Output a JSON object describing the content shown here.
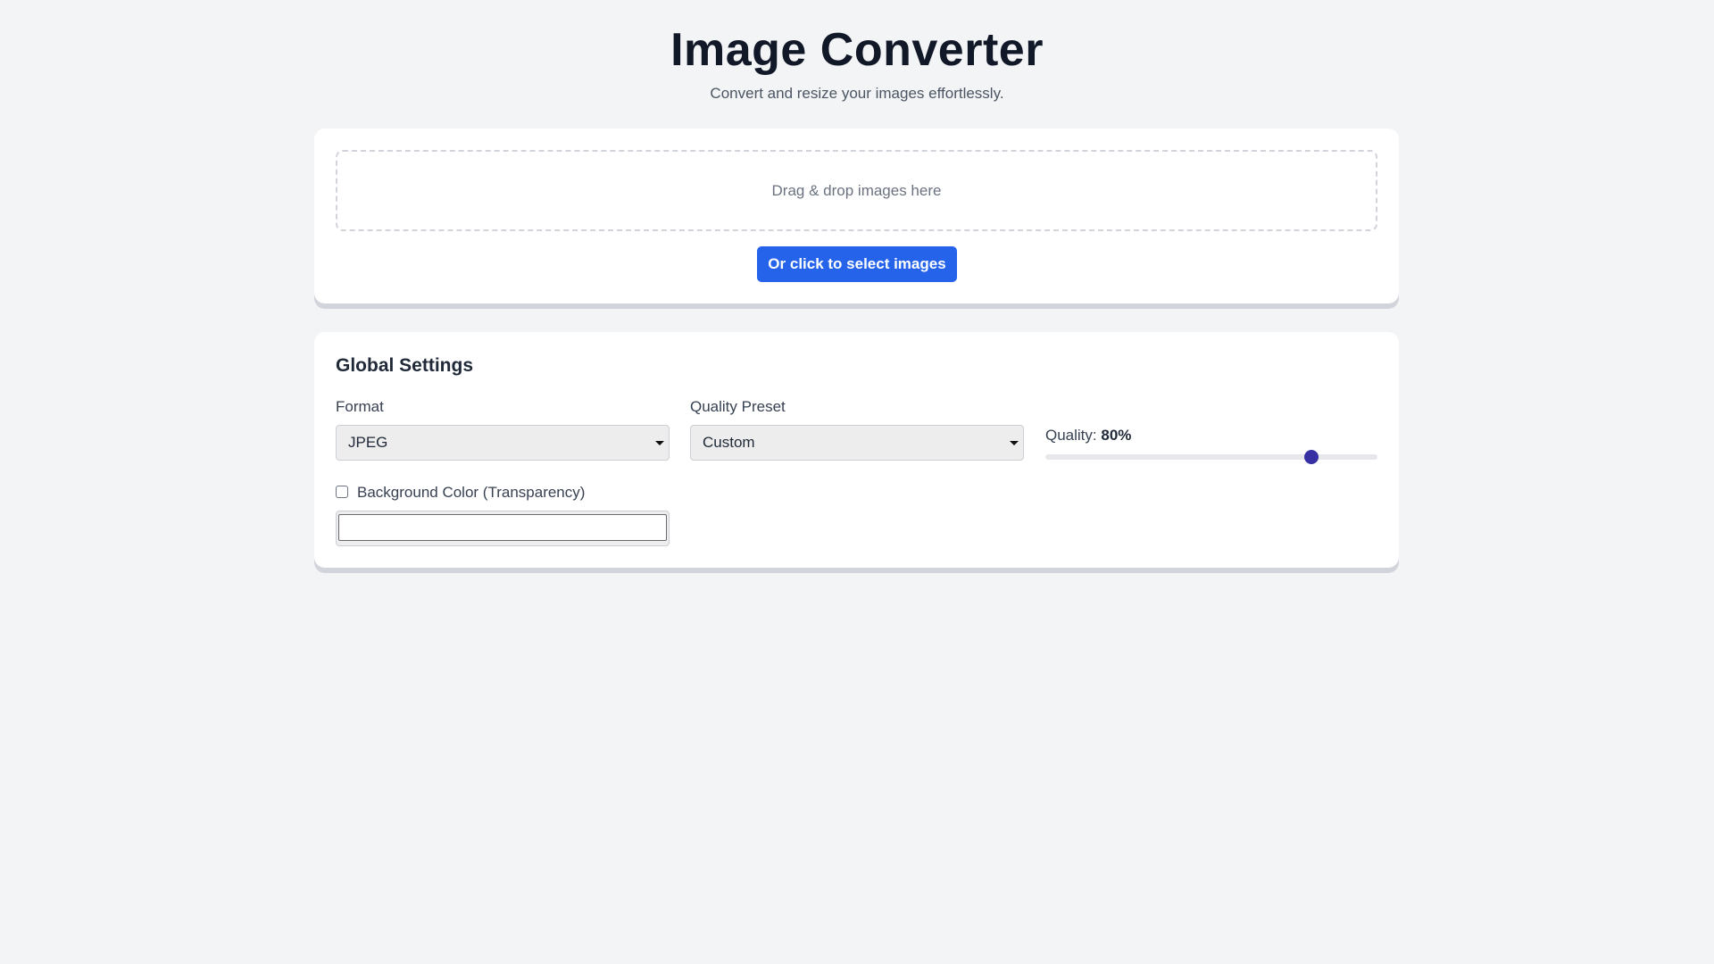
{
  "header": {
    "title": "Image Converter",
    "subtitle": "Convert and resize your images effortlessly."
  },
  "upload": {
    "dropzone_text": "Drag & drop images here",
    "select_button_label": "Or click to select images"
  },
  "settings": {
    "title": "Global Settings",
    "format": {
      "label": "Format",
      "value": "JPEG"
    },
    "quality_preset": {
      "label": "Quality Preset",
      "value": "Custom"
    },
    "quality": {
      "label": "Quality:",
      "value_text": "80%",
      "value": 0.8
    },
    "background_color": {
      "label": "Background Color (Transparency)",
      "checked": false,
      "value": ""
    }
  },
  "colors": {
    "page_background": "#f3f4f6",
    "primary_button": "#2563eb",
    "slider_thumb": "#3730a3"
  }
}
